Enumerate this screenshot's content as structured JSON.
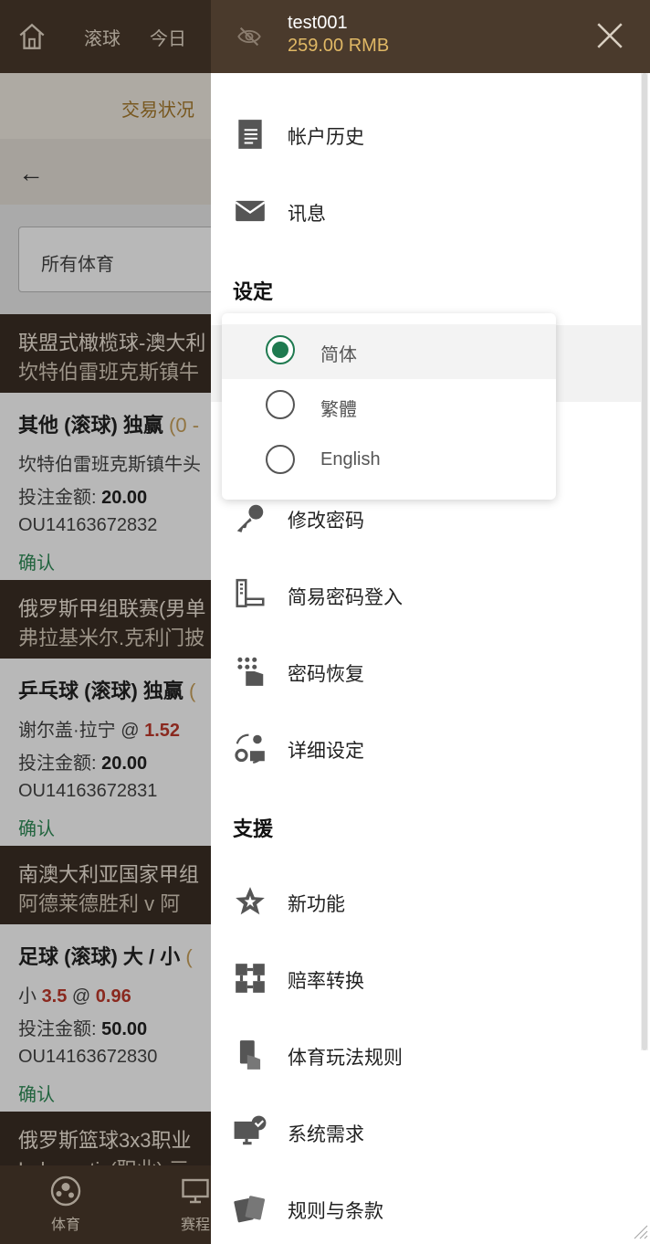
{
  "app": {
    "nav": [
      "滚球",
      "今日"
    ],
    "tab": "交易状况",
    "filter": "所有体育",
    "leagues": [
      {
        "title": "联盟式橄榄球-澳大利",
        "sub": "坎特伯雷班克斯镇牛"
      },
      {
        "title": "俄罗斯甲组联赛(男单",
        "sub": "弗拉基米尔.克利门披"
      },
      {
        "title": "南澳大利亚国家甲组",
        "sub": "阿德莱德胜利   v   阿"
      },
      {
        "title": "俄罗斯篮球3x3职业",
        "sub": "Lokomotiv(职业) 三"
      }
    ],
    "bets": [
      {
        "title": "其他 (滚球) 独赢",
        "score": "(0 -",
        "sel_pre": "坎特伯雷班克斯镇牛头",
        "sel_mid": "",
        "odds": "",
        "stake_label": "投注金额:",
        "stake": "20.00",
        "ref": "OU14163672832",
        "status": "确认"
      },
      {
        "title": "乒乓球 (滚球) 独赢",
        "score": "(",
        "sel_pre": "谢尔盖·拉宁 @ ",
        "sel_mid": "",
        "odds": "1.52",
        "stake_label": "投注金额:",
        "stake": "20.00",
        "ref": "OU14163672831",
        "status": "确认"
      },
      {
        "title": "足球 (滚球) 大 / 小",
        "score": "(",
        "sel_pre": "小 ",
        "sel_mid": "3.5",
        "odds": "0.96",
        "stake_label": "投注金额:",
        "stake": "50.00",
        "ref": "OU14163672830",
        "status": "确认"
      }
    ],
    "bottom": [
      "体育",
      "赛程"
    ]
  },
  "drawer": {
    "username": "test001",
    "balance": "259.00  RMB",
    "items_top": [
      {
        "icon": "document-icon",
        "label": "帐户历史"
      },
      {
        "icon": "mail-icon",
        "label": "讯息"
      }
    ],
    "section_settings": "设定",
    "items_settings": [
      {
        "icon": "key-icon",
        "label": "修改密码"
      },
      {
        "icon": "pin-login-icon",
        "label": "简易密码登入"
      },
      {
        "icon": "password-recovery-icon",
        "label": "密码恢复"
      },
      {
        "icon": "settings-detail-icon",
        "label": "详细设定"
      }
    ],
    "section_support": "支援",
    "items_support": [
      {
        "icon": "star-icon",
        "label": "新功能"
      },
      {
        "icon": "odds-convert-icon",
        "label": "赔率转换"
      },
      {
        "icon": "rules-icon",
        "label": "体育玩法规则"
      },
      {
        "icon": "system-icon",
        "label": "系统需求"
      },
      {
        "icon": "terms-icon",
        "label": "规则与条款"
      }
    ]
  },
  "language": {
    "options": [
      "简体",
      "繁體",
      "English"
    ],
    "selected": "简体",
    "accent": "#1f7a50"
  }
}
